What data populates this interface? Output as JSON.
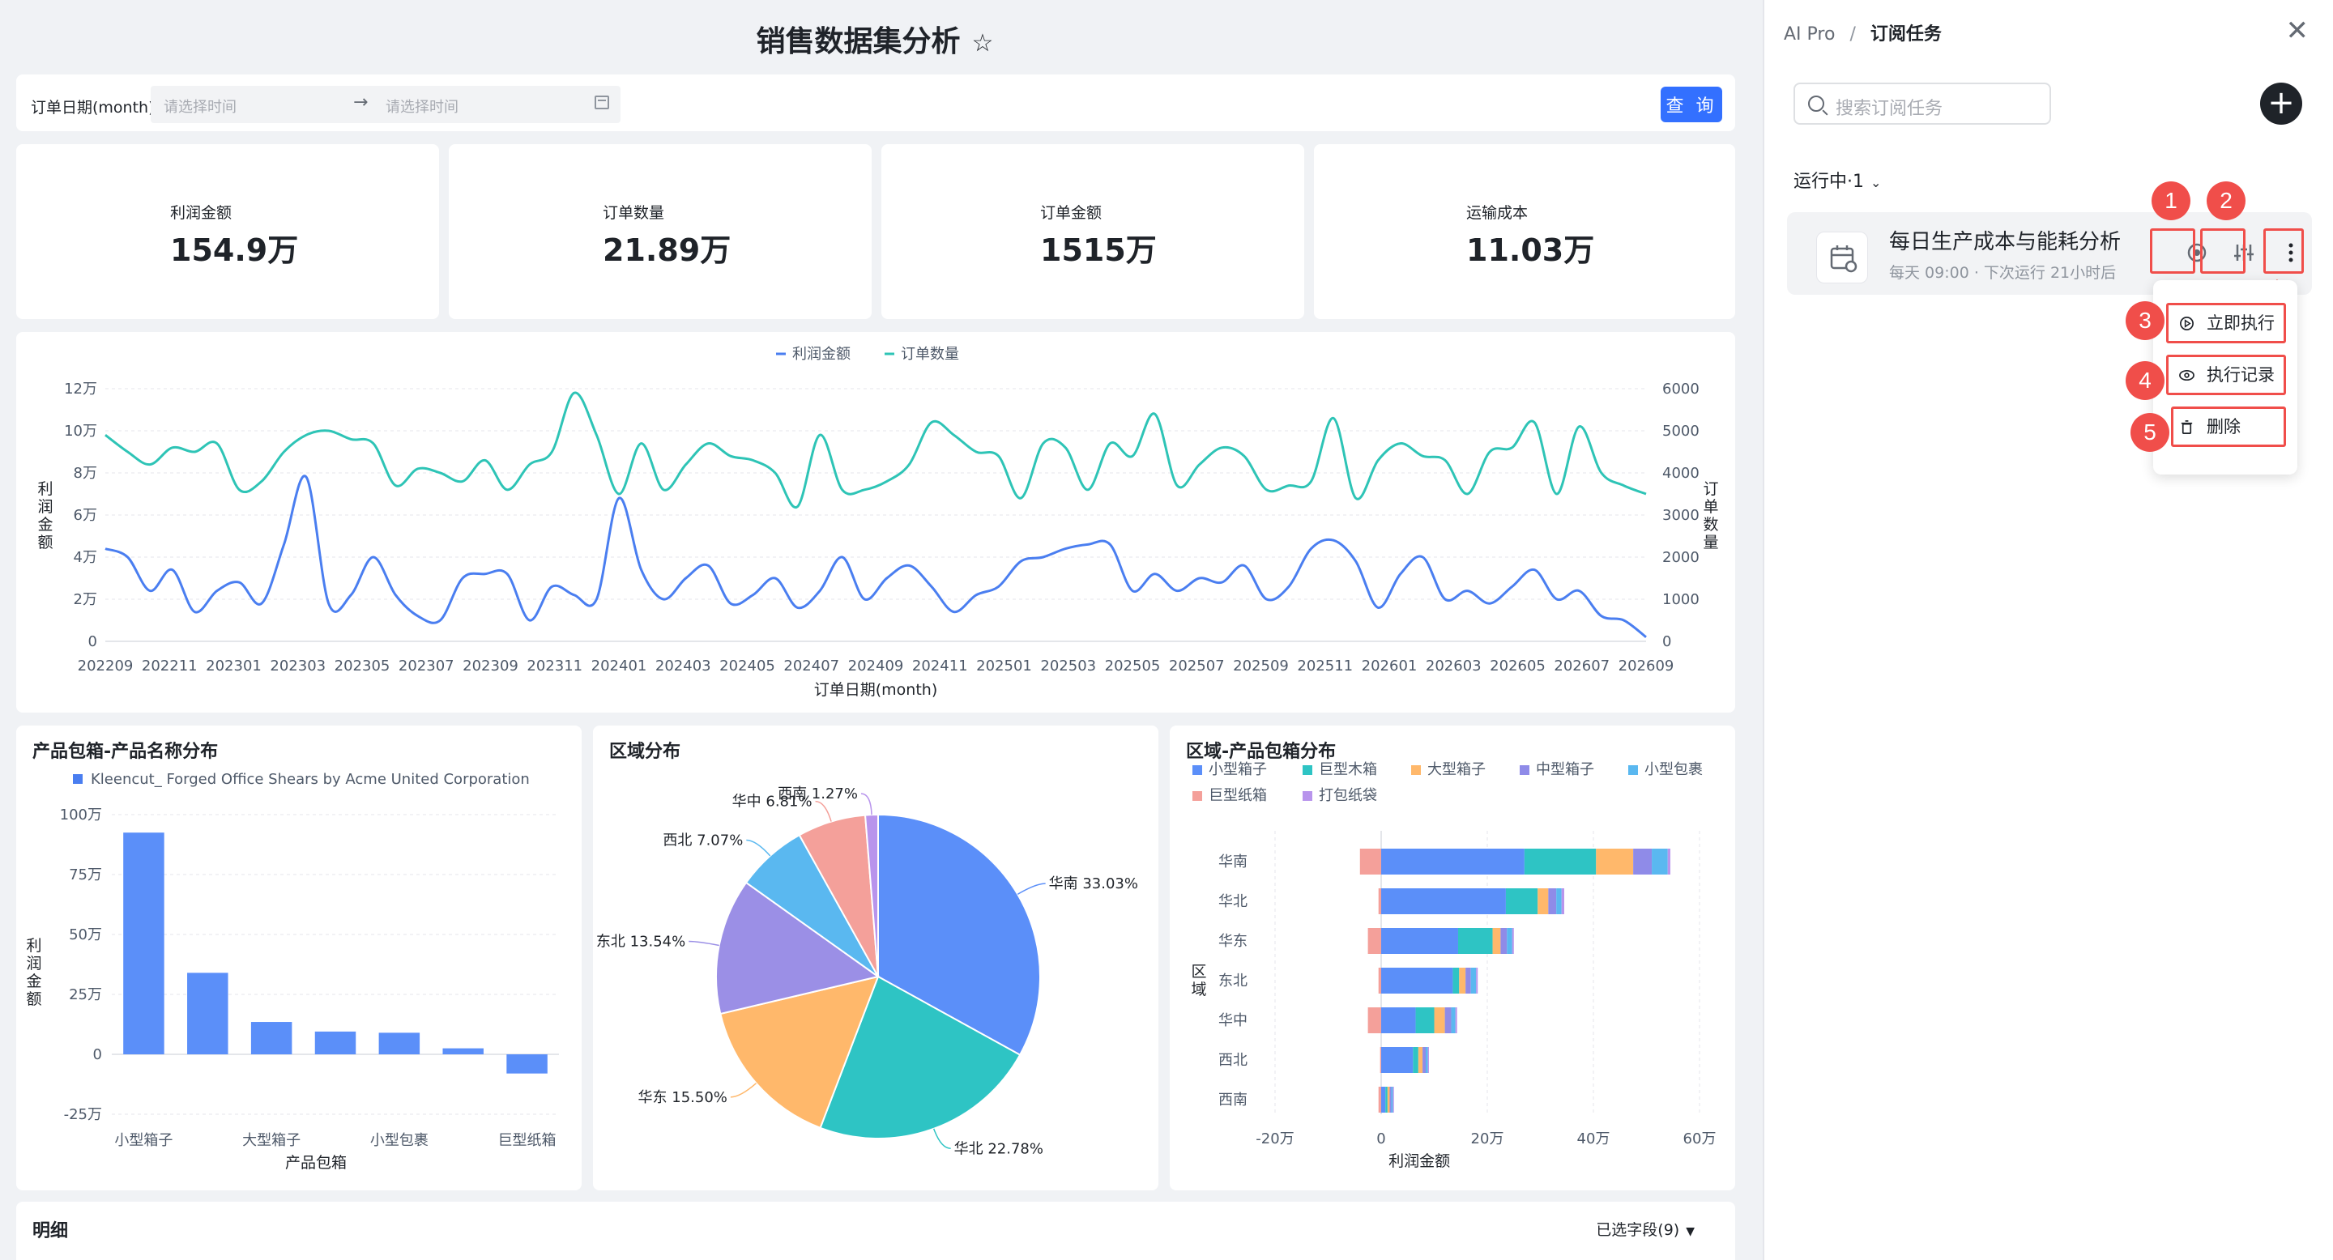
{
  "dashboard": {
    "title": "销售数据集分析",
    "filter": {
      "label": "订单日期(month)",
      "start_placeholder": "请选择时间",
      "end_placeholder": "请选择时间",
      "query_label": "查 询"
    },
    "kpis": [
      {
        "label": "利润金额",
        "value": "154.9万"
      },
      {
        "label": "订单数量",
        "value": "21.89万"
      },
      {
        "label": "订单金额",
        "value": "1515万"
      },
      {
        "label": "运输成本",
        "value": "11.03万"
      }
    ],
    "details": {
      "title": "明细",
      "fields_label": "已选字段(9)"
    }
  },
  "panel": {
    "breadcrumb_root": "AI Pro",
    "breadcrumb_sep": "/",
    "breadcrumb_current": "订阅任务",
    "search_placeholder": "搜索订阅任务",
    "running_label": "运行中·1",
    "task": {
      "title": "每日生产成本与能耗分析",
      "schedule": "每天 09:00 · 下次运行 21小时后"
    },
    "menu": [
      {
        "label": "立即执行",
        "icon": "play-circle-icon"
      },
      {
        "label": "执行记录",
        "icon": "eye-icon"
      },
      {
        "label": "删除",
        "icon": "trash-icon"
      }
    ],
    "badges": [
      "1",
      "2",
      "3",
      "4",
      "5"
    ],
    "highlight_color": "#f04e4a"
  },
  "chart_data": [
    {
      "type": "line",
      "title": "",
      "legend": [
        "利润金额",
        "订单数量"
      ],
      "legend_placement": "top-center",
      "xlabel": "订单日期(month)",
      "ylabel_left": "利润金额",
      "ylabel_right": "订单数量",
      "x_ticks": [
        "202209",
        "202211",
        "202301",
        "202303",
        "202305",
        "202307",
        "202309",
        "202311",
        "202401",
        "202403",
        "202405",
        "202407",
        "202409",
        "202411",
        "202501",
        "202503",
        "202505",
        "202507",
        "202509",
        "202511",
        "202601",
        "202603",
        "202605",
        "202607",
        "202609"
      ],
      "y_left_ticks": [
        "0",
        "2万",
        "4万",
        "6万",
        "8万",
        "10万",
        "12万"
      ],
      "y_left_range": [
        0,
        120000
      ],
      "y_right_ticks": [
        "0",
        "1000",
        "2000",
        "3000",
        "4000",
        "5000",
        "6000"
      ],
      "y_right_range": [
        0,
        6000
      ],
      "series": [
        {
          "name": "利润金额",
          "axis": "left",
          "color": "#4a7ef0",
          "values": [
            44000,
            40000,
            24000,
            34000,
            14000,
            24000,
            28000,
            18000,
            46000,
            78000,
            18000,
            22000,
            40000,
            22000,
            12000,
            10000,
            30000,
            32000,
            32000,
            10000,
            26000,
            22000,
            20000,
            68000,
            34000,
            20000,
            30000,
            36000,
            18000,
            22000,
            30000,
            16000,
            24000,
            40000,
            20000,
            30000,
            36000,
            26000,
            14000,
            22000,
            26000,
            38000,
            40000,
            44000,
            46000,
            46000,
            24000,
            32000,
            24000,
            30000,
            28000,
            36000,
            20000,
            26000,
            44000,
            48000,
            38000,
            16000,
            32000,
            40000,
            20000,
            24000,
            18000,
            26000,
            34000,
            20000,
            24000,
            12000,
            10000,
            2000
          ]
        },
        {
          "name": "订单数量",
          "axis": "right",
          "color": "#2ec4b6",
          "values": [
            4900,
            4500,
            4200,
            4600,
            4500,
            4700,
            3600,
            3800,
            4500,
            4900,
            5000,
            4800,
            4700,
            3700,
            4100,
            4000,
            3800,
            4300,
            3600,
            4200,
            4500,
            5900,
            4900,
            3500,
            4700,
            3600,
            4200,
            4700,
            4400,
            4300,
            4000,
            3200,
            4900,
            3600,
            3600,
            3800,
            4200,
            5200,
            4900,
            4500,
            4400,
            3400,
            4700,
            4600,
            3600,
            4700,
            4400,
            5400,
            3700,
            4200,
            4600,
            4400,
            3600,
            3700,
            3800,
            5300,
            3400,
            4300,
            4700,
            4400,
            4300,
            3500,
            4500,
            4600,
            5200,
            3500,
            5100,
            4000,
            3700,
            3500
          ]
        }
      ]
    },
    {
      "type": "bar",
      "title": "产品包箱-产品名称分布",
      "legend": [
        "Kleencut_ Forged Office Shears by Acme United Corporation"
      ],
      "categories": [
        "小型箱子",
        "",
        "大型箱子",
        "",
        "小型包裹",
        "",
        "巨型纸箱"
      ],
      "xlabel": "产品包箱",
      "ylabel": "利润金额",
      "y_ticks": [
        "-25万",
        "0",
        "25万",
        "50万",
        "75万",
        "100万"
      ],
      "ylim": [
        -250000,
        1000000
      ],
      "values": [
        925000,
        340000,
        135000,
        95000,
        90000,
        25000,
        -80000
      ]
    },
    {
      "type": "pie",
      "title": "区域分布",
      "labels": [
        "华南 33.03%",
        "华北 22.78%",
        "华东 15.50%",
        "东北 13.54%",
        "西北 7.07%",
        "华中 6.81%",
        "西南 1.27%"
      ],
      "values": [
        33.03,
        22.78,
        15.5,
        13.54,
        7.07,
        6.81,
        1.27
      ],
      "colors": [
        "#5b8ff9",
        "#2ec4c4",
        "#ffb86b",
        "#9b8fe6",
        "#5ab8f0",
        "#f4a09a",
        "#b894ec"
      ]
    },
    {
      "type": "bar",
      "orientation": "horizontal-stacked",
      "title": "区域-产品包箱分布",
      "legend": [
        "小型箱子",
        "巨型木箱",
        "大型箱子",
        "中型箱子",
        "小型包裹",
        "巨型纸箱",
        "打包纸袋"
      ],
      "legend_colors": [
        "#5b8ff9",
        "#2ec4c4",
        "#ffb86b",
        "#8f8be8",
        "#5ab8f0",
        "#f4a09a",
        "#b894ec"
      ],
      "categories": [
        "华南",
        "华北",
        "华东",
        "东北",
        "华中",
        "西北",
        "西南"
      ],
      "ylabel": "区域",
      "xlabel": "利润金额",
      "x_ticks": [
        "-20万",
        "0",
        "20万",
        "40万",
        "60万"
      ],
      "xlim": [
        -200000,
        600000
      ],
      "series": [
        {
          "name": "小型箱子",
          "values": [
            270000,
            235000,
            145000,
            135000,
            65000,
            60000,
            8000
          ]
        },
        {
          "name": "巨型木箱",
          "values": [
            135000,
            60000,
            65000,
            12000,
            35000,
            10000,
            4000
          ]
        },
        {
          "name": "大型箱子",
          "values": [
            70000,
            20000,
            15000,
            12000,
            20000,
            8000,
            4000
          ]
        },
        {
          "name": "中型箱子",
          "values": [
            35000,
            15000,
            12000,
            10000,
            12000,
            6000,
            3000
          ]
        },
        {
          "name": "小型包裹",
          "values": [
            30000,
            10000,
            10000,
            10000,
            8000,
            4000,
            3000
          ]
        },
        {
          "name": "巨型纸箱",
          "values": [
            -40000,
            -5000,
            -25000,
            -5000,
            -25000,
            -2000,
            -5000
          ]
        },
        {
          "name": "打包纸袋",
          "values": [
            5000,
            5000,
            3000,
            3000,
            3000,
            2000,
            2000
          ]
        }
      ]
    }
  ]
}
